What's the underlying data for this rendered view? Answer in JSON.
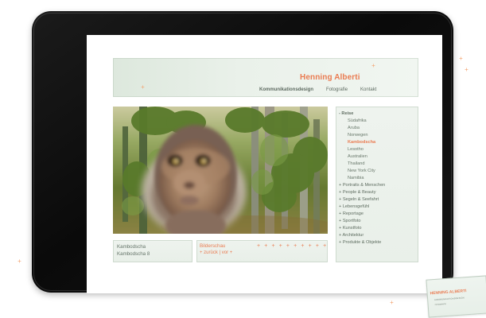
{
  "site": {
    "brand": "Henning Alberti",
    "nav": {
      "items": [
        "Kommunikationsdesign",
        "Fotografie",
        "Kontakt"
      ]
    }
  },
  "sidebar": {
    "items": [
      {
        "label": "- Reise",
        "level": 0,
        "type": "heading"
      },
      {
        "label": "Südafrika",
        "level": 1
      },
      {
        "label": "Aruba",
        "level": 1
      },
      {
        "label": "Norwegen",
        "level": 1
      },
      {
        "label": "Kambodscha",
        "level": 1,
        "active": true
      },
      {
        "label": "Lesotho",
        "level": 1
      },
      {
        "label": "Australien",
        "level": 1
      },
      {
        "label": "Thailand",
        "level": 1
      },
      {
        "label": "New York City",
        "level": 1
      },
      {
        "label": "Namibia",
        "level": 1
      },
      {
        "label": "+ Portraits & Menschen",
        "level": 0
      },
      {
        "label": "+ People & Beauty",
        "level": 0
      },
      {
        "label": "+ Segeln & Seefahrt",
        "level": 0
      },
      {
        "label": "+ Lebensgefühl",
        "level": 0
      },
      {
        "label": "+ Reportage",
        "level": 0
      },
      {
        "label": "+ Sportfoto",
        "level": 0
      },
      {
        "label": "+ Kunstfoto",
        "level": 0
      },
      {
        "label": "+ Architektur",
        "level": 0
      },
      {
        "label": "+ Produkte & Objekte",
        "level": 0
      }
    ]
  },
  "info_left": {
    "line1": "Kambodscha",
    "line2": "Kambodscha 8"
  },
  "info_mid": {
    "title": "Bilderschau",
    "pager": "+ zurück  | vor +",
    "marks": "+ + + + + + + + + +"
  },
  "note": {
    "name": "HENNING ALBERTI",
    "sub1": "KOMMUNIKATIONSDESIGN",
    "sub2": "FOTOGRAFIE"
  },
  "colors": {
    "accent": "#ea7c52",
    "panel": "#eef3ee",
    "text": "#66756a"
  }
}
